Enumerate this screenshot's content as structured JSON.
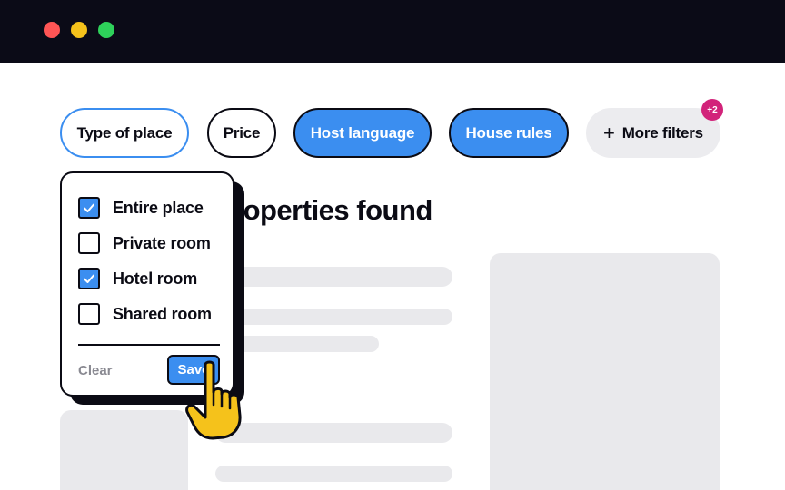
{
  "window": {
    "controls": [
      "close",
      "minimize",
      "maximize"
    ]
  },
  "filters": {
    "type_of_place": "Type of place",
    "price": "Price",
    "host_language": "Host language",
    "house_rules": "House rules",
    "more_filters": "More filters",
    "more_filters_badge": "+2"
  },
  "results": {
    "title_visible": "roperties found"
  },
  "popup": {
    "options": [
      {
        "label": "Entire place",
        "checked": true
      },
      {
        "label": "Private room",
        "checked": false
      },
      {
        "label": "Hotel room",
        "checked": true
      },
      {
        "label": "Shared room",
        "checked": false
      }
    ],
    "clear_label": "Clear",
    "save_label": "Save"
  },
  "colors": {
    "accent": "#3b8ef0",
    "badge": "#d2237a",
    "titlebar": "#0b0b17",
    "skeleton": "#e9e9ec",
    "cursor": "#f5c21b"
  },
  "icons": {
    "more_filters": "plus-icon",
    "checkbox_checked": "checkmark-icon",
    "pointer": "hand-pointer-icon"
  }
}
